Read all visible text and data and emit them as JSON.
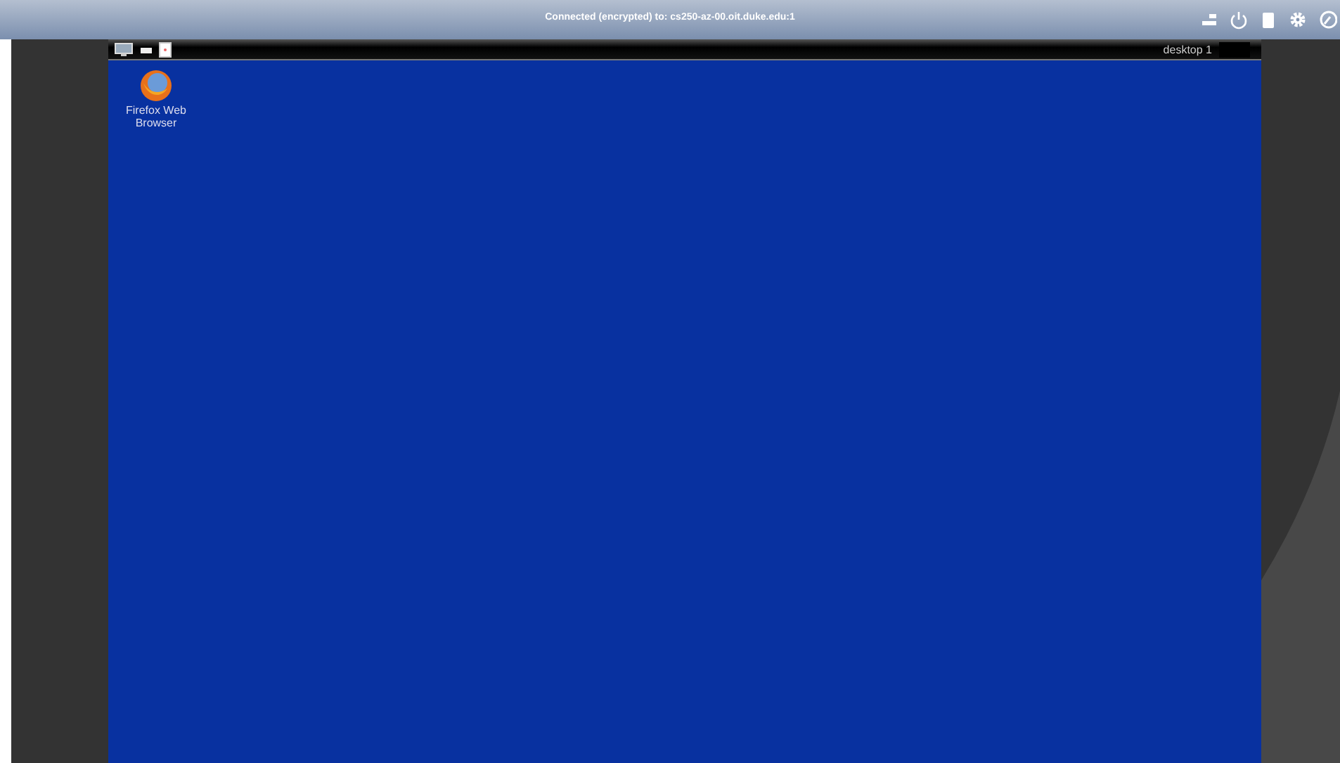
{
  "toolbar": {
    "title": "Connected (encrypted) to: cs250-az-00.oit.duke.edu:1"
  },
  "remote_panel": {
    "workspace": "desktop 1"
  },
  "desktop_icons": [
    {
      "label": "Firefox Web Browser"
    }
  ]
}
